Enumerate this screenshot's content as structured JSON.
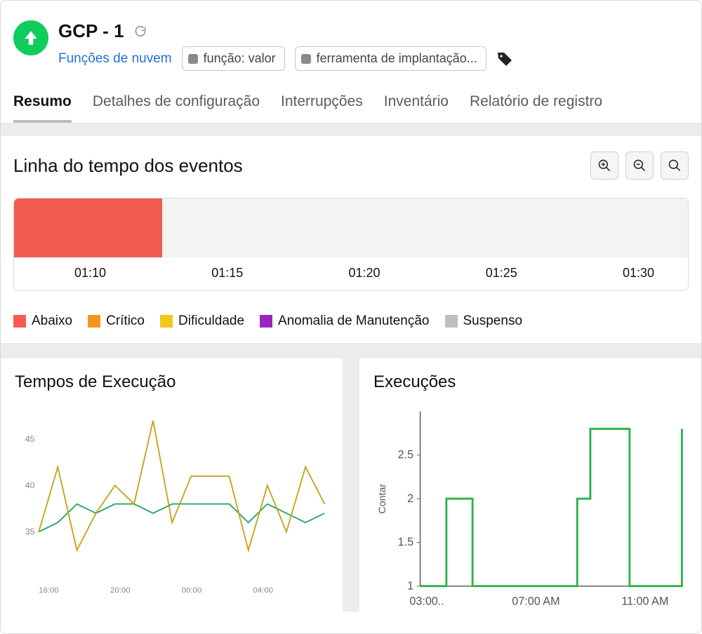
{
  "header": {
    "title": "GCP - 1",
    "subtitle_link": "Funções de nuvem",
    "tags": [
      {
        "label": "função: valor"
      },
      {
        "label": "ferramenta de implantação..."
      }
    ]
  },
  "tabs": [
    {
      "label": "Resumo",
      "active": true
    },
    {
      "label": "Detalhes de configuração"
    },
    {
      "label": "Interrupções"
    },
    {
      "label": "Inventário"
    },
    {
      "label": "Relatório de registro"
    }
  ],
  "timeline": {
    "title": "Linha do tempo dos eventos",
    "ticks": [
      "01:10",
      "01:15",
      "01:20",
      "01:25",
      "01:30"
    ],
    "red_fraction": 0.22
  },
  "legend": [
    {
      "label": "Abaixo",
      "color": "#f45b51"
    },
    {
      "label": "Crítico",
      "color": "#f4951d"
    },
    {
      "label": "Dificuldade",
      "color": "#f2c71d"
    },
    {
      "label": "Anomalia de Manutenção",
      "color": "#9a25c3"
    },
    {
      "label": "Suspenso",
      "color": "#bfbfbf"
    }
  ],
  "left_card": {
    "title": "Tempos de Execução"
  },
  "right_card": {
    "title": "Execuções",
    "ylabel": "Contar"
  },
  "chart_data": [
    {
      "type": "line",
      "title": "Tempos de Execução",
      "xlabel": "",
      "ylabel": "",
      "x_ticks": [
        "16:00",
        "20:00",
        "00:00",
        "04:00"
      ],
      "y_ticks": [
        35,
        40,
        45
      ],
      "ylim": [
        30,
        48
      ],
      "x": [
        16,
        17,
        18,
        19,
        20,
        21,
        22,
        23,
        0,
        1,
        2,
        3,
        4,
        5,
        6,
        7
      ],
      "series": [
        {
          "name": "green",
          "color": "#27a768",
          "values": [
            35,
            36,
            38,
            37,
            38,
            38,
            37,
            38,
            38,
            38,
            38,
            36,
            38,
            37,
            36,
            37
          ]
        },
        {
          "name": "yellow",
          "color": "#c6a51c",
          "values": [
            35,
            42,
            33,
            37,
            40,
            38,
            47,
            36,
            41,
            41,
            41,
            33,
            40,
            35,
            42,
            38
          ]
        }
      ]
    },
    {
      "type": "line",
      "title": "Execuções",
      "xlabel": "",
      "ylabel": "Contar",
      "x_ticks": [
        "03:00..",
        "07:00 AM",
        "11:00 AM"
      ],
      "y_ticks": [
        1,
        1.5,
        2,
        2.5
      ],
      "ylim": [
        1,
        3
      ],
      "x": [
        3,
        4,
        5,
        6,
        7,
        8,
        9,
        9.5,
        10,
        11,
        12,
        13
      ],
      "series": [
        {
          "name": "count",
          "color": "#2bb24c",
          "values": [
            1,
            2,
            1,
            1,
            1,
            1,
            2,
            2.8,
            2.8,
            1,
            1,
            2.8
          ]
        }
      ]
    }
  ]
}
